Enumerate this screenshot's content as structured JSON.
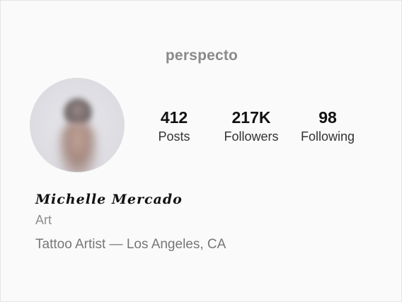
{
  "profile": {
    "username": "perspecto",
    "full_name": "Michelle Mercado",
    "category": "Art",
    "bio": "Tattoo Artist — Los Angeles, CA"
  },
  "stats": {
    "posts": {
      "value": "412",
      "label": "Posts"
    },
    "followers": {
      "value": "217K",
      "label": "Followers"
    },
    "following": {
      "value": "98",
      "label": "Following"
    }
  },
  "colors": {
    "background": "#fafafa",
    "username": "#8a8a8a",
    "stat_number": "#111111",
    "secondary_text": "#8e8e8e"
  }
}
